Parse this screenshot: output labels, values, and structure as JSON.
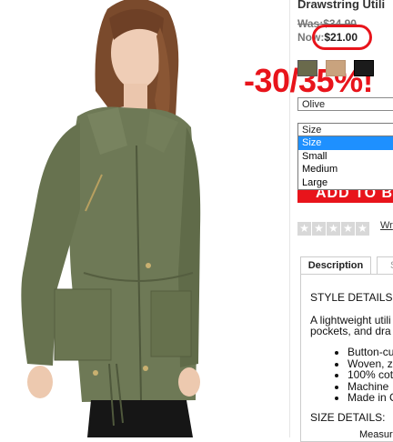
{
  "product": {
    "title": "Drawstring Utili",
    "was_price": "Was:$34.90",
    "now_label": "Now:",
    "now_price": "$21.00",
    "discount_annotation": "-30/35%!",
    "swatches": [
      {
        "name": "Olive",
        "color": "#6a6a4c"
      },
      {
        "name": "Tan",
        "color": "#c9a37e"
      },
      {
        "name": "Black",
        "color": "#1b1b1b"
      }
    ],
    "color_select": "Olive",
    "size_select": "Size",
    "size_options": [
      "Size",
      "Small",
      "Medium",
      "Large"
    ],
    "add_button": "ADD TO B",
    "rating_stars": 5,
    "write_review": "Wr"
  },
  "tabs": {
    "description": "Description",
    "other": "S"
  },
  "description": {
    "style_heading": "STYLE DETAILS",
    "para_line1": "A lightweight utili",
    "para_line2": "pockets, and dra",
    "bullets": [
      "Button-cu",
      "Woven, z",
      "100% cot",
      "Machine",
      "Made in C"
    ],
    "size_heading": "SIZE DETAILS:",
    "measure": "Measure"
  },
  "colors": {
    "accent_red": "#e8141b",
    "select_highlight": "#1e90ff"
  }
}
